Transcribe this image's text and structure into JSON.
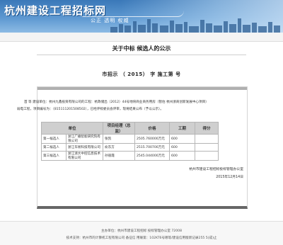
{
  "header": {
    "site_logo": "杭州建设工程招标网",
    "slogan": "公正  透明  权威"
  },
  "notice": {
    "title": "关于中标  候选人的公示",
    "doc_no": "市招示 （ 2015） 字 施工第 号",
    "paragraph": "首 等 建设单位：杭州九鑫投资有限公司的工程：杭政储出（2012）44号地块商业商务用房（暂估 杭州浙商创新发展中心项目）弱电工程，项目编号为：（815111201508502），已经评标委员会评审，现将结果公布（予以公示）。",
    "signer": "杭州市建设工程招标投标管理办公室",
    "date": "2015年12月14日"
  },
  "table": {
    "headers": [
      "单位",
      "项目经理（总监）",
      "价格",
      "工期",
      "得分"
    ],
    "rows": [
      [
        "第一候选人",
        "浙江广播智能研究院有限公司",
        "张凯",
        "2505.760000万元",
        "600",
        ""
      ],
      [
        "第二候选人",
        "浙江华易科技有限公司",
        "俞东方",
        "2515.700700万元",
        "600",
        ""
      ],
      [
        "第三候选人",
        "浙江浙大中控信息技术有限公司",
        "孙丽霞",
        "2545.044000万元",
        "600",
        ""
      ]
    ]
  },
  "footer": {
    "line1": "主办单位：杭州市建设工程招标  投标管理办公室  72008",
    "line2": "技术支持：杭州市的计算机工程有限公司  备征信  用联第：102KT6号哪等/建设信用版新记录255 5(成)止"
  },
  "colors": {
    "banner": "#3a78b8",
    "table_header": "#cfcfcf"
  }
}
